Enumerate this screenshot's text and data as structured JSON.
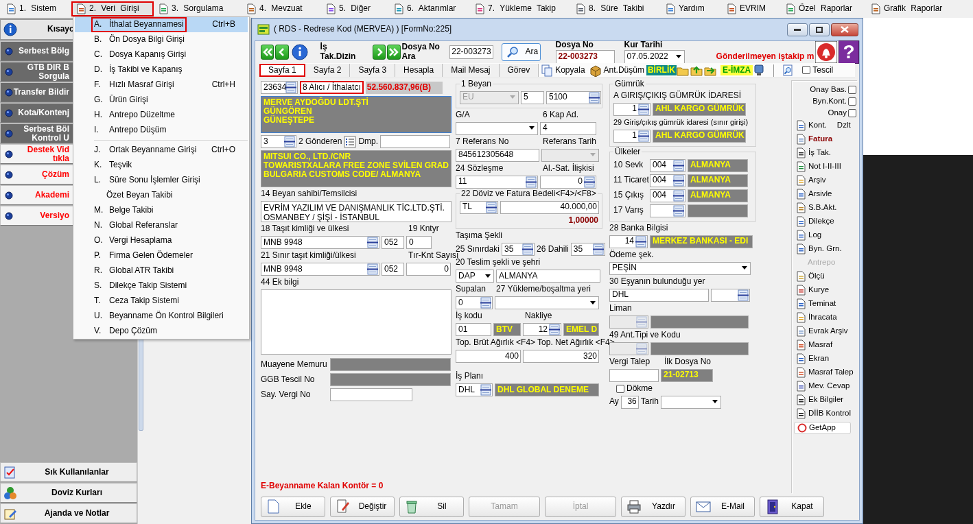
{
  "menubar": [
    {
      "label": "1. Sistem",
      "selected": false,
      "annotated": false
    },
    {
      "label": "2. Veri Girişi",
      "selected": true,
      "annotated": true
    },
    {
      "label": "3. Sorgulama",
      "selected": false,
      "annotated": false
    },
    {
      "label": "4. Mevzuat",
      "selected": false,
      "annotated": false
    },
    {
      "label": "5. Diğer",
      "selected": false,
      "annotated": false
    },
    {
      "label": "6. Aktarımlar",
      "selected": false,
      "annotated": false
    },
    {
      "label": "7. Yükleme Takip",
      "selected": false,
      "annotated": false
    },
    {
      "label": "8. Süre Takibi",
      "selected": false,
      "annotated": false
    },
    {
      "label": "Yardım",
      "selected": false,
      "annotated": false
    },
    {
      "label": "EVRIM",
      "selected": false,
      "annotated": false
    },
    {
      "label": "Özel Raporlar",
      "selected": false,
      "annotated": false
    },
    {
      "label": "Grafik Raporlar",
      "selected": false,
      "annotated": false
    }
  ],
  "dropdown": [
    {
      "kind": "item",
      "key": "A.",
      "label": "İthalat Beyannamesi",
      "shortcut": "Ctrl+B",
      "selected": true,
      "annotated": true
    },
    {
      "kind": "item",
      "key": "B.",
      "label": "Ön Dosya Bilgi Girişi",
      "selected": false,
      "annotated": false
    },
    {
      "kind": "item",
      "key": "C.",
      "label": "Dosya Kapanış Girişi",
      "selected": false,
      "annotated": false
    },
    {
      "kind": "item",
      "key": "D.",
      "label": "İş Takibi ve Kapanış",
      "selected": false,
      "annotated": false
    },
    {
      "kind": "item",
      "key": "F.",
      "label": "Hızlı Masraf Girişi",
      "shortcut": "Ctrl+H",
      "selected": false,
      "annotated": false
    },
    {
      "kind": "item",
      "key": "G.",
      "label": "Ürün Girişi",
      "selected": false,
      "annotated": false
    },
    {
      "kind": "item",
      "key": "H.",
      "label": "Antrepo Düzeltme",
      "selected": false,
      "annotated": false
    },
    {
      "kind": "item",
      "key": "I.",
      "label": "Antrepo Düşüm",
      "selected": false,
      "annotated": false
    },
    {
      "kind": "separator"
    },
    {
      "kind": "item",
      "key": "J.",
      "label": "Ortak Beyanname Girişi",
      "shortcut": "Ctrl+O",
      "selected": false,
      "annotated": false
    },
    {
      "kind": "item",
      "key": "K.",
      "label": "Teşvik",
      "selected": false,
      "annotated": false
    },
    {
      "kind": "item",
      "key": "L.",
      "label": "Süre Sonu İşlemler Girişi",
      "selected": false,
      "annotated": false
    },
    {
      "kind": "item",
      "label": "Özet Beyan Takibi",
      "selected": false,
      "annotated": false
    },
    {
      "kind": "item",
      "key": "M.",
      "label": "Belge Takibi",
      "selected": false,
      "annotated": false
    },
    {
      "kind": "item",
      "key": "N.",
      "label": "Global Referanslar",
      "selected": false,
      "annotated": false
    },
    {
      "kind": "item",
      "key": "O.",
      "label": "Vergi Hesaplama",
      "selected": false,
      "annotated": false
    },
    {
      "kind": "item",
      "key": "P.",
      "label": "Firma Gelen Ödemeler",
      "selected": false,
      "annotated": false
    },
    {
      "kind": "item",
      "key": "R.",
      "label": "Global ATR Takibi",
      "selected": false,
      "annotated": false
    },
    {
      "kind": "item",
      "key": "S.",
      "label": "Dilekçe Takip Sistemi",
      "selected": false,
      "annotated": false
    },
    {
      "kind": "item",
      "key": "T.",
      "label": "Ceza Takip Sistemi",
      "selected": false,
      "annotated": false
    },
    {
      "kind": "item",
      "key": "U.",
      "label": "Beyanname Ön Kontrol Bilgileri",
      "selected": false,
      "annotated": false
    },
    {
      "kind": "item",
      "key": "V.",
      "label": "Depo Çözüm",
      "selected": false,
      "annotated": false
    }
  ],
  "sidebar": {
    "header": "Kısayo",
    "items": [
      {
        "lines": [
          "Serbest Bölg"
        ],
        "color": "#ffffff"
      },
      {
        "lines": [
          "GTB DIR B",
          "Sorgula"
        ],
        "color": "#ffffff"
      },
      {
        "lines": [
          "Transfer Bildir"
        ],
        "color": "#ffffff"
      },
      {
        "lines": [
          "Kota/Kontenj"
        ],
        "color": "#ffffff"
      },
      {
        "lines": [
          "Serbest Böl",
          "Kontrol U"
        ],
        "color": "#ffffff"
      },
      {
        "lines": [
          "Destek Vid",
          "tıkla"
        ],
        "color": "#ff0000"
      },
      {
        "lines": [
          "Çözüm"
        ],
        "color": "#ff0000"
      },
      {
        "lines": [
          "Akademi"
        ],
        "color": "#ff0000"
      },
      {
        "lines": [
          "Versiyo"
        ],
        "color": "#ff0000"
      }
    ],
    "bottom": [
      "Sık Kullanılanlar",
      "Doviz Kurları",
      "Ajanda ve Notlar"
    ]
  },
  "window": {
    "title": "( RDS - Redrese Kod (MERVEA) ) [FormNo:225]"
  },
  "toolbar": {
    "dizin_label": "İş Tak.Dizin",
    "search_label": "Dosya No Ara",
    "search_value": "22-003273",
    "search_button": "Ara",
    "dosya_no_label": "Dosya No",
    "dosya_no": "22-003273",
    "kur_label": "Kur Tarihi",
    "kur_value": "07.05.2022",
    "warning": "Gönderilmeyen iştakip m",
    "help_glyph": "?"
  },
  "tabs": [
    {
      "label": "Sayfa 1",
      "selected": true,
      "annotated": true
    },
    {
      "label": "Sayfa 2",
      "selected": false,
      "annotated": false
    },
    {
      "label": "Sayfa 3",
      "selected": false,
      "annotated": false
    },
    {
      "label": "Hesapla",
      "selected": false,
      "annotated": false
    },
    {
      "label": "Mail Mesaj",
      "selected": false,
      "annotated": false
    },
    {
      "label": "Görev",
      "selected": false,
      "annotated": false
    }
  ],
  "tools": {
    "copy": "Kopyala",
    "ant": "Ant.Düşüm",
    "birlik": "BİRLİK",
    "eimza": "E-İMZA",
    "tescil": {
      "label": "Tescil",
      "checked": false
    }
  },
  "form": {
    "columns": [
      {
        "rows": [
          [
            {
              "kind": "lookup",
              "value": "23634"
            },
            {
              "kind": "tag",
              "label": "8 Alıcı / İthalatcı",
              "annotated": true
            },
            {
              "kind": "amount",
              "value": "52.560.837,96(B)"
            }
          ],
          [
            {
              "kind": "block",
              "lines": [
                "MERVE AYDOĞDU LDT.ŞTİ",
                "GÜNGÖREN",
                "GÜNEŞTEPE"
              ]
            }
          ],
          [
            {
              "kind": "lookup",
              "value": "3"
            },
            {
              "kind": "label",
              "label": "2 Gönderen"
            },
            {
              "kind": "listicon"
            },
            {
              "kind": "label",
              "label": "Dmp."
            },
            {
              "kind": "input"
            }
          ],
          [
            {
              "kind": "block",
              "lines": [
                "MITSUI CO., LTD./CNR",
                "TOWARISTXALARA FREE ZONE SVİLEN GRAD",
                "BULGARIA CUSTOMS CODE/ ALMANYA"
              ]
            }
          ],
          [
            {
              "kind": "label",
              "label": "14 Beyan sahibi/Temsilcisi"
            }
          ],
          [
            {
              "kind": "memo",
              "lines": [
                "EVRİM YAZILIM VE DANIŞMANLIK TİC.LTD.ŞTİ.",
                "OSMANBEY / ŞİŞİ - İSTANBUL"
              ]
            }
          ],
          [
            {
              "kind": "label",
              "label": "18 Taşıt kimliği ve ülkesi"
            },
            {
              "kind": "label",
              "label": "19 Kntyr"
            }
          ],
          [
            {
              "kind": "lookup",
              "value": "MNB 9948"
            },
            {
              "kind": "input",
              "value": "052"
            },
            {
              "kind": "input",
              "value": "0"
            }
          ],
          [
            {
              "kind": "label",
              "label": "21 Sınır taşıt kimliği/ülkesi"
            },
            {
              "kind": "label",
              "label": "Tır-Knt Sayısı"
            }
          ],
          [
            {
              "kind": "lookup",
              "value": "MNB 9948"
            },
            {
              "kind": "input",
              "value": "052"
            },
            {
              "kind": "input",
              "value": "0"
            }
          ],
          [
            {
              "kind": "label",
              "label": "44 Ek bilgi"
            }
          ],
          [
            {
              "kind": "memo"
            }
          ],
          [
            {
              "kind": "label",
              "label": "Muayene Memuru"
            },
            {
              "kind": "display"
            }
          ],
          [
            {
              "kind": "label",
              "label": "GGB Tescil No"
            },
            {
              "kind": "display"
            }
          ],
          [
            {
              "kind": "label",
              "label": "Say. Vergi No"
            },
            {
              "kind": "input"
            }
          ]
        ]
      },
      {
        "rows": [
          {
            "group": "1 Beyan",
            "rows": [
              [
                {
                  "kind": "select",
                  "value": "EU",
                  "disabled": true
                },
                {
                  "kind": "input",
                  "value": "5"
                },
                {
                  "kind": "lookup",
                  "value": "5100"
                }
              ]
            ]
          },
          [
            {
              "kind": "label",
              "label": "G/A"
            },
            {
              "kind": "label",
              "label": "6 Kap Ad."
            }
          ],
          [
            {
              "kind": "select"
            },
            {
              "kind": "input",
              "value": "4"
            }
          ],
          [
            {
              "kind": "label",
              "label": "7 Referans No"
            },
            {
              "kind": "label",
              "label": "Referans Tarih"
            }
          ],
          [
            {
              "kind": "input",
              "value": "845612305648"
            },
            {
              "kind": "select",
              "disabled": true
            }
          ],
          [
            {
              "kind": "label",
              "label": "24 Sözleşme"
            },
            {
              "kind": "label",
              "label": "Al.-Sat. İlişkisi"
            }
          ],
          [
            {
              "kind": "lookup",
              "value": "11"
            },
            {
              "kind": "lookup",
              "value": "0"
            }
          ],
          {
            "group": "22 Döviz ve Fatura Bedeli<F4>/<F8>",
            "rows": [
              [
                {
                  "kind": "lookup",
                  "value": "TL"
                },
                {
                  "kind": "input",
                  "value": "40.000,00"
                }
              ]
            ],
            "note": {
              "kind": "rate",
              "value": "1,00000"
            }
          },
          [
            {
              "kind": "label",
              "label": "Taşıma Şekli"
            }
          ],
          [
            {
              "kind": "label",
              "label": "25 Sınırdaki"
            },
            {
              "kind": "lookup",
              "value": "35"
            },
            {
              "kind": "label",
              "label": "26 Dahili"
            },
            {
              "kind": "lookup",
              "value": "35"
            }
          ],
          [
            {
              "kind": "label",
              "label": "20 Teslim şekli ve şehri"
            }
          ],
          [
            {
              "kind": "select",
              "value": "DAP"
            },
            {
              "kind": "input",
              "value": "ALMANYA"
            }
          ],
          [
            {
              "kind": "label",
              "label": "Supalan"
            },
            {
              "kind": "label",
              "label": "27 Yükleme/boşaltma yeri"
            }
          ],
          [
            {
              "kind": "lookup",
              "value": "0"
            },
            {
              "kind": "select"
            }
          ],
          [
            {
              "kind": "label",
              "label": "İş kodu"
            },
            {
              "kind": "label",
              "label": "Nakliye"
            }
          ],
          [
            {
              "kind": "input",
              "value": "01"
            },
            {
              "kind": "display",
              "value": "BTV"
            },
            {
              "kind": "lookup",
              "value": "12"
            },
            {
              "kind": "display",
              "value": "EMEL D"
            }
          ],
          [
            {
              "kind": "label",
              "label": "Top. Brüt Ağırlık <F4>"
            },
            {
              "kind": "label",
              "label": "Top. Net Ağırlık <F4>"
            }
          ],
          [
            {
              "kind": "input",
              "value": "400"
            },
            {
              "kind": "input",
              "value": "320"
            }
          ],
          [
            {
              "kind": "label",
              "label": "İş Planı"
            }
          ],
          [
            {
              "kind": "lookup",
              "value": "DHL"
            },
            {
              "kind": "display",
              "value": "DHL GLOBAL DENEME"
            }
          ]
        ]
      },
      {
        "rows": [
          {
            "group": "Gümrük",
            "rows": [
              [
                {
                  "kind": "label",
                  "label": "A GIRIŞ/ÇIKIŞ GÜMRÜK İDARESİ"
                }
              ],
              [
                {
                  "kind": "lookup",
                  "value": "1"
                },
                {
                  "kind": "display",
                  "value": "AHL KARGO GÜMRÜK"
                }
              ],
              [
                {
                  "kind": "label",
                  "label": "29 Giriş/çıkış gümrük idaresi (sınır girişi)"
                }
              ],
              [
                {
                  "kind": "lookup",
                  "value": "1"
                },
                {
                  "kind": "display",
                  "value": "AHL KARGO GÜMRÜK"
                }
              ]
            ]
          },
          {
            "group": "Ülkeler",
            "rows": [
              [
                {
                  "kind": "label",
                  "label": "10 Sevk"
                },
                {
                  "kind": "lookup",
                  "value": "004"
                },
                {
                  "kind": "display",
                  "value": "ALMANYA"
                }
              ],
              [
                {
                  "kind": "label",
                  "label": "11 Ticaret"
                },
                {
                  "kind": "lookup",
                  "value": "004"
                },
                {
                  "kind": "display",
                  "value": "ALMANYA"
                }
              ],
              [
                {
                  "kind": "label",
                  "label": "15 Çıkış"
                },
                {
                  "kind": "lookup",
                  "value": "004"
                },
                {
                  "kind": "display",
                  "value": "ALMANYA"
                }
              ],
              [
                {
                  "kind": "label",
                  "label": "17 Varış"
                },
                {
                  "kind": "lookup"
                },
                {
                  "kind": "display"
                }
              ]
            ]
          },
          [
            {
              "kind": "label",
              "label": "28 Banka Bilgisi"
            }
          ],
          [
            {
              "kind": "lookup",
              "value": "14"
            },
            {
              "kind": "display",
              "value": "MERKEZ BANKASI - EDI"
            }
          ],
          [
            {
              "kind": "label",
              "label": "Ödeme şek."
            }
          ],
          [
            {
              "kind": "select",
              "value": "PEŞİN"
            }
          ],
          [
            {
              "kind": "label",
              "label": "30 Eşyanın bulunduğu yer"
            }
          ],
          [
            {
              "kind": "input",
              "value": "DHL"
            },
            {
              "kind": "lookup"
            }
          ],
          [
            {
              "kind": "label",
              "label": "Liman"
            }
          ],
          [
            {
              "kind": "lookup",
              "disabled": true
            },
            {
              "kind": "display"
            }
          ],
          [
            {
              "kind": "label",
              "label": "49 Ant.Tipi ve Kodu"
            }
          ],
          [
            {
              "kind": "lookup",
              "disabled": true
            },
            {
              "kind": "display"
            }
          ],
          [
            {
              "kind": "label",
              "label": "Vergi Talep"
            },
            {
              "kind": "label",
              "label": "İlk Dosya No"
            }
          ],
          [
            {
              "kind": "input"
            },
            {
              "kind": "display",
              "value": "21-02713"
            }
          ],
          [
            {
              "kind": "checkbox",
              "label": "Dökme",
              "checked": false
            }
          ],
          [
            {
              "kind": "label",
              "label": "Ay"
            },
            {
              "kind": "input",
              "value": "36"
            },
            {
              "kind": "label",
              "label": "Tarih"
            },
            {
              "kind": "select"
            }
          ]
        ]
      }
    ],
    "remaining": "E-Beyanname Kalan Kontör = 0"
  },
  "side_panel": {
    "checks": [
      {
        "label": "Onay Bas.",
        "checked": false
      },
      {
        "label": "Byn.Kont.",
        "checked": false
      },
      {
        "label": "Onay",
        "checked": false
      }
    ],
    "items": [
      {
        "kind": "normal",
        "label": "Kont.",
        "extra": "Dzlt"
      },
      {
        "kind": "strong",
        "label": "Fatura"
      },
      {
        "kind": "normal",
        "label": "İş Tak."
      },
      {
        "kind": "normal",
        "label": "Not I-II-III"
      },
      {
        "kind": "normal",
        "label": "Arşiv"
      },
      {
        "kind": "normal",
        "label": "Arsivle"
      },
      {
        "kind": "normal",
        "label": "S.B.Akt."
      },
      {
        "kind": "normal",
        "label": "Dilekçe"
      },
      {
        "kind": "normal",
        "label": "Log"
      },
      {
        "kind": "normal",
        "label": "Byn. Grn."
      },
      {
        "kind": "disabled",
        "label": "Antrepo"
      },
      {
        "kind": "normal",
        "label": "Ölçü"
      },
      {
        "kind": "normal",
        "label": "Kurye"
      },
      {
        "kind": "normal",
        "label": "Teminat"
      },
      {
        "kind": "normal",
        "label": "İhracata"
      },
      {
        "kind": "normal",
        "label": "Evrak Arşiv"
      },
      {
        "kind": "normal",
        "label": "Masraf"
      },
      {
        "kind": "normal",
        "label": "Ekran"
      },
      {
        "kind": "normal",
        "label": "Masraf Talep"
      },
      {
        "kind": "normal",
        "label": "Mev. Cevap"
      },
      {
        "kind": "normal",
        "label": "Ek Bilgiler"
      },
      {
        "kind": "normal",
        "label": "DİİB Kontrol"
      },
      {
        "kind": "button",
        "label": "GetApp"
      }
    ]
  },
  "buttons": [
    {
      "label": "Ekle",
      "disabled": false
    },
    {
      "label": "Değiştir",
      "disabled": false
    },
    {
      "label": "Sil",
      "disabled": false
    },
    {
      "label": "Tamam",
      "disabled": true
    },
    {
      "label": "İptal",
      "disabled": true
    },
    {
      "label": "Yazdır",
      "disabled": false
    },
    {
      "label": "E-Mail",
      "disabled": false
    },
    {
      "label": "Kapat",
      "disabled": false
    }
  ]
}
